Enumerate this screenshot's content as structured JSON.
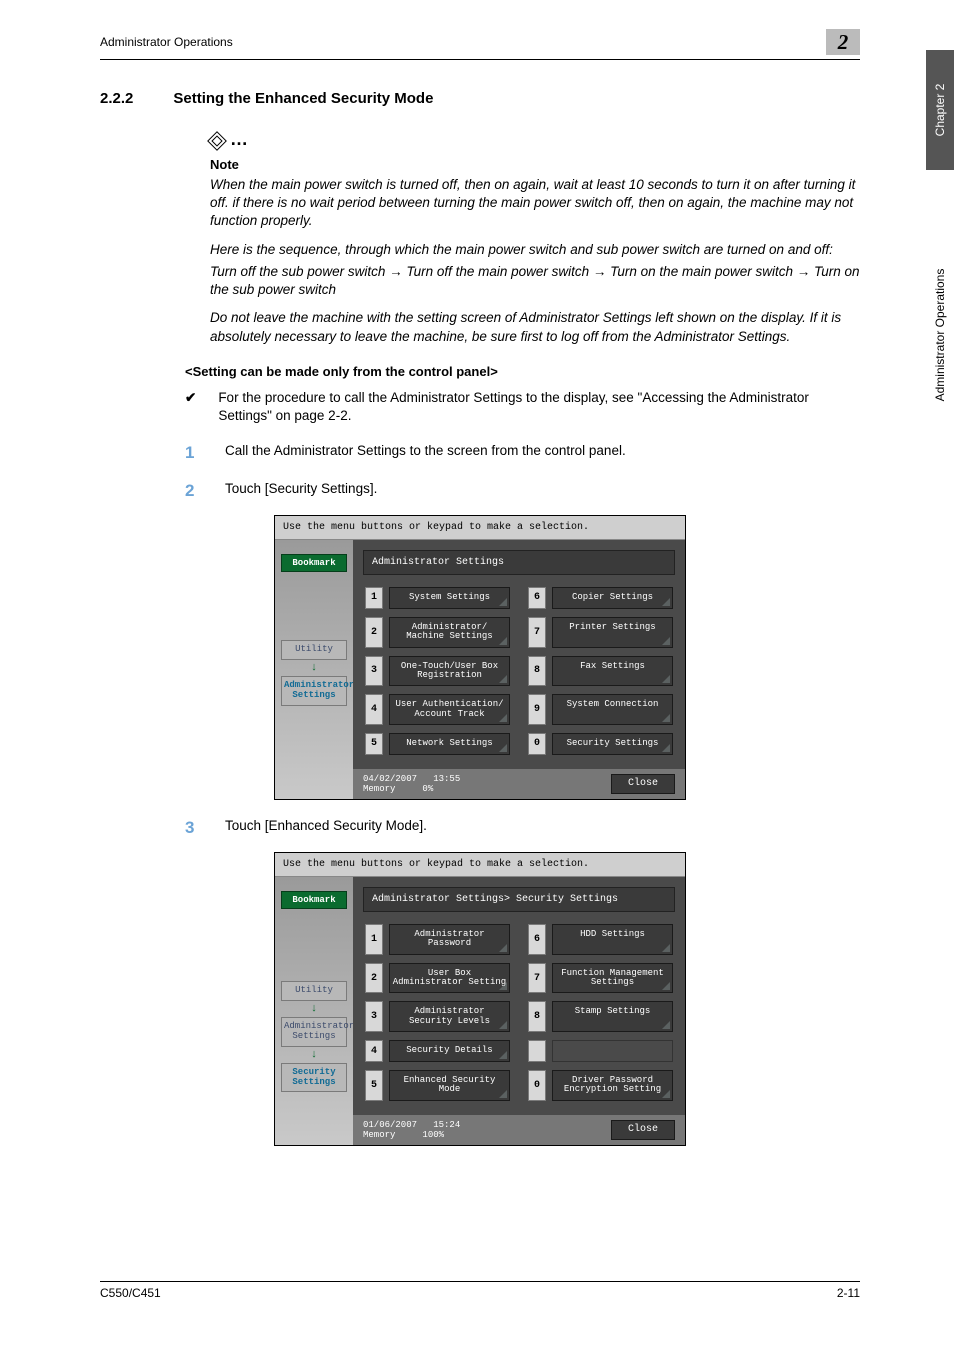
{
  "running_head": "Administrator Operations",
  "chapter_number": "2",
  "section": {
    "number": "2.2.2",
    "title": "Setting the Enhanced Security Mode"
  },
  "note": {
    "title": "Note",
    "para1": "When the main power switch is turned off, then on again, wait at least 10 seconds to turn it on after turning it off. if there is no wait period between turning the main power switch off, then on again, the machine may not function properly.",
    "para2": "Here is the sequence, through which the main power switch and sub power switch are turned on and off:",
    "para3": "Turn off the sub power switch → Turn off the main power switch → Turn on the main power switch → Turn on the sub power switch",
    "para4": "Do not leave the machine with the setting screen of Administrator Settings left shown on the display. If it is absolutely necessary to leave the machine, be sure first to log off from the Administrator Settings."
  },
  "subhead": "<Setting can be made only from the control panel>",
  "precond_mark": "✔",
  "precond": "For the procedure to call the Administrator Settings to the display, see \"Accessing the Administrator Settings\" on page 2-2.",
  "steps": {
    "s1": {
      "n": "1",
      "t": "Call the Administrator Settings to the screen from the control panel."
    },
    "s2": {
      "n": "2",
      "t": "Touch [Security Settings]."
    },
    "s3": {
      "n": "3",
      "t": "Touch [Enhanced Security Mode]."
    }
  },
  "panel1": {
    "instruction": "Use the menu buttons or keypad to make a selection.",
    "bookmark": "Bookmark",
    "nav1": "Utility",
    "nav2": "Administrator Settings",
    "header": "Administrator Settings",
    "left": [
      {
        "n": "1",
        "l": "System Settings"
      },
      {
        "n": "2",
        "l": "Administrator/\nMachine Settings"
      },
      {
        "n": "3",
        "l": "One-Touch/User Box\nRegistration"
      },
      {
        "n": "4",
        "l": "User Authentication/\nAccount Track"
      },
      {
        "n": "5",
        "l": "Network Settings"
      }
    ],
    "right": [
      {
        "n": "6",
        "l": "Copier Settings"
      },
      {
        "n": "7",
        "l": "Printer Settings"
      },
      {
        "n": "8",
        "l": "Fax Settings"
      },
      {
        "n": "9",
        "l": "System Connection"
      },
      {
        "n": "0",
        "l": "Security Settings"
      }
    ],
    "date": "04/02/2007",
    "time": "13:55",
    "mem_label": "Memory",
    "mem_val": "0%",
    "close": "Close"
  },
  "panel2": {
    "instruction": "Use the menu buttons or keypad to make a selection.",
    "bookmark": "Bookmark",
    "nav1": "Utility",
    "nav2": "Administrator Settings",
    "nav3": "Security Settings",
    "header": "Administrator Settings> Security Settings",
    "left": [
      {
        "n": "1",
        "l": "Administrator Password"
      },
      {
        "n": "2",
        "l": "User Box Administrator\nSetting"
      },
      {
        "n": "3",
        "l": "Administrator Security\nLevels"
      },
      {
        "n": "4",
        "l": "Security Details"
      },
      {
        "n": "5",
        "l": "Enhanced Security Mode"
      }
    ],
    "right": [
      {
        "n": "6",
        "l": "HDD Settings"
      },
      {
        "n": "7",
        "l": "Function Management Settings"
      },
      {
        "n": "8",
        "l": "Stamp Settings"
      },
      {
        "n": "",
        "l": ""
      },
      {
        "n": "0",
        "l": "Driver Password\nEncryption Setting"
      }
    ],
    "date": "01/06/2007",
    "time": "15:24",
    "mem_label": "Memory",
    "mem_val": "100%",
    "close": "Close"
  },
  "side_tabs": {
    "chapter": "Chapter 2",
    "section": "Administrator Operations"
  },
  "footer": {
    "model": "C550/C451",
    "page": "2-11"
  }
}
